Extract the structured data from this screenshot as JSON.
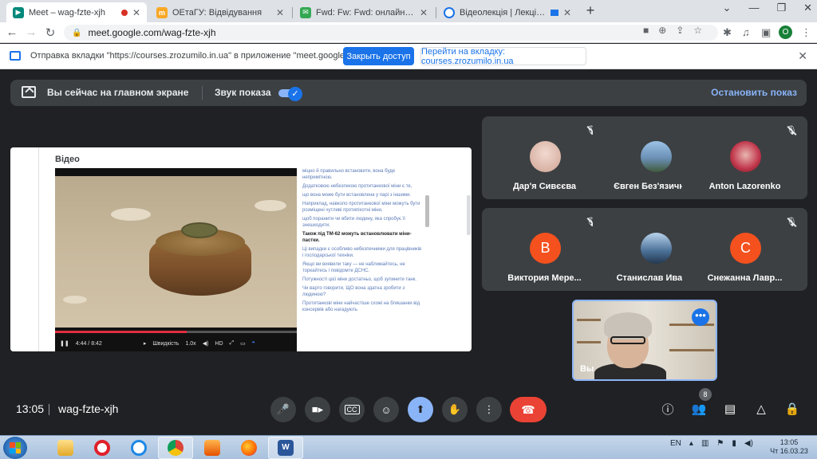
{
  "browser": {
    "tabs": [
      {
        "title": "Meet – wag-fzte-xjh",
        "active": true
      },
      {
        "title": "ОЕтаГУ: Відвідування",
        "active": false
      },
      {
        "title": "Fwd: Fw: Fwd: онлайн-курс • olg",
        "active": false
      },
      {
        "title": "Відеолекція | Лекція 2. Безп",
        "active": false
      }
    ],
    "new_tab": "+",
    "url": "meet.google.com/wag-fzte-xjh",
    "profile_initial": "O"
  },
  "infobar": {
    "message": "Отправка вкладки \"https://courses.zrozumilo.in.ua\" в приложение \"meet.google.com\"...",
    "allow_label": "Закрыть доступ",
    "goto_label": "Перейти на вкладку: courses.zrozumilo.in.ua"
  },
  "present_bar": {
    "label": "Вы сейчас на главном экране",
    "sound_label": "Звук показа",
    "stop_label": "Остановить показ"
  },
  "shared_screen": {
    "heading": "Відео",
    "video": {
      "time": "4:44 / 8:42",
      "progress": 0.545,
      "speed_label": "Швидкість",
      "speed_value": "1.0x",
      "quality": "HD"
    },
    "transcript": [
      {
        "text": "міцно й правильно встановити, вона буде непримітною.",
        "bold": false
      },
      {
        "text": "Додатковою небезпекою протитанкової міни є те,",
        "bold": false
      },
      {
        "text": "що вона може бути встановлена у парі з іншими.",
        "bold": false
      },
      {
        "text": "Наприклад, навколо протитанкової міни можуть бути розміщені чутливі протипіхотні міни,",
        "bold": false
      },
      {
        "text": "щоб поранити чи вбити людину, яка спробує її знешкодити.",
        "bold": false
      },
      {
        "text": "Також під ТМ-62 можуть встановлювати міни-пастки.",
        "bold": true
      },
      {
        "text": "Ці випадки є особливо небезпечними для працівників і господарської техніки.",
        "bold": false
      },
      {
        "text": "Якщо ви виявили таку — не наближайтесь, не торкайтесь і повідомте ДСНС.",
        "bold": false
      },
      {
        "text": "Потужності цієї міни достатньо, щоб зупинити танк.",
        "bold": false
      },
      {
        "text": "Чи варто говорити, ЩО вона здатна зробити з людиною?",
        "bold": false
      },
      {
        "text": "Протитанкові міни найчастіше схожі на бляшанки від консервів або нагадують",
        "bold": false
      }
    ]
  },
  "participants": [
    {
      "name": "Дар'я Сивєєва",
      "initial": "",
      "color": "#e9c9c0"
    },
    {
      "name": "Євген Без'язични...",
      "initial": "",
      "color": "#6b8fb5"
    },
    {
      "name": "Anton Lazorenko",
      "initial": "",
      "color": "#c0354a"
    },
    {
      "name": "Виктория Мере...",
      "initial": "В",
      "color": "#f4511e"
    },
    {
      "name": "Станислав Ивах...",
      "initial": "",
      "color": "#4a6f96"
    },
    {
      "name": "Снежанна Лавр...",
      "initial": "С",
      "color": "#f4511e"
    }
  ],
  "self_tile": {
    "label": "Вы",
    "more": "•••"
  },
  "footer": {
    "time": "13:05",
    "meeting_code": "wag-fzte-xjh",
    "people_count": "8"
  },
  "taskbar": {
    "lang": "EN",
    "clock_time": "13:05",
    "clock_date": "Чт 16.03.23"
  },
  "colors": {
    "meet_bg": "#202124",
    "tile_bg": "#3c4043",
    "accent_blue": "#1a73e8",
    "link_blue": "#8ab4f8",
    "end_call_red": "#ea4335"
  }
}
